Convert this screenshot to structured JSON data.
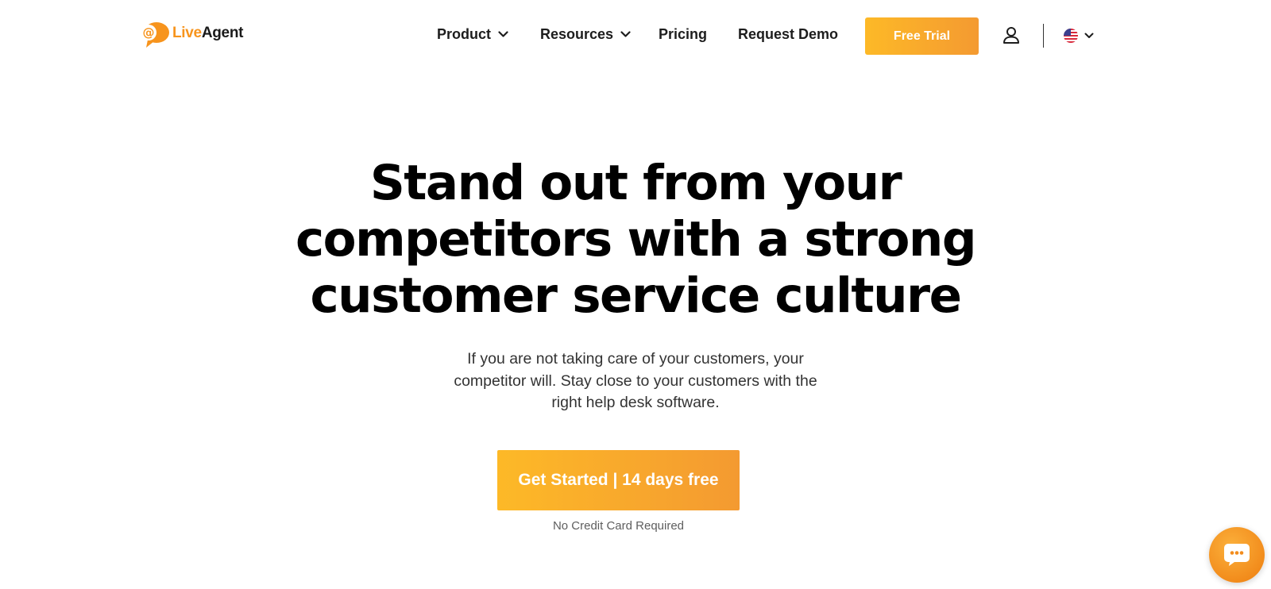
{
  "header": {
    "logo": {
      "live": "Live",
      "agent": "Agent",
      "icon": "liveagent-logo-icon"
    },
    "nav": [
      {
        "label": "Product",
        "has_dropdown": true
      },
      {
        "label": "Resources",
        "has_dropdown": true
      },
      {
        "label": "Pricing",
        "has_dropdown": false
      },
      {
        "label": "Request Demo",
        "has_dropdown": false
      }
    ],
    "free_trial_label": "Free Trial",
    "user_icon": "user-icon",
    "language": {
      "flag_icon": "us-flag-icon",
      "has_dropdown": true
    }
  },
  "hero": {
    "title_lines": [
      "Stand out from your",
      "competitors with a strong",
      "customer service culture"
    ],
    "subtitle_lines": [
      "If you are not taking care of your customers, your",
      "competitor will. Stay close to your customers with the",
      "right help desk software."
    ],
    "cta_label": "Get Started | 14 days free",
    "cta_note": "No Credit Card Required"
  },
  "chat_widget": {
    "icon": "chat-bubble-icon"
  },
  "colors": {
    "accent_start": "#fdb927",
    "accent_end": "#f49a31",
    "logo_orange": "#f7941d",
    "text_dark": "#000000"
  }
}
